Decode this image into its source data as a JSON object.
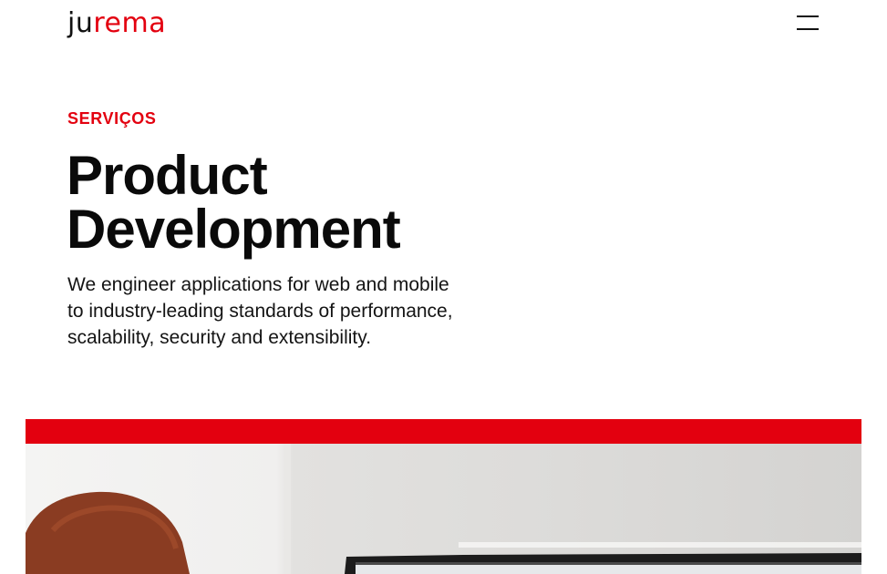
{
  "header": {
    "logo": {
      "part1": "ju",
      "part2": "rema"
    },
    "menu_icon": "hamburger-menu-icon"
  },
  "hero_text": {
    "eyebrow": "SERVIÇOS",
    "title_line1": "Product",
    "title_line2": "Development",
    "description_line1": "We engineer applications for web and mobile",
    "description_line2": "to industry-leading standards of performance,",
    "description_line3": "scalability, security and extensibility."
  },
  "colors": {
    "accent": "#e3000f",
    "text": "#0a0a0a",
    "background": "#ffffff"
  },
  "hero_image": {
    "subject": "person with red hair at a computer monitor"
  }
}
